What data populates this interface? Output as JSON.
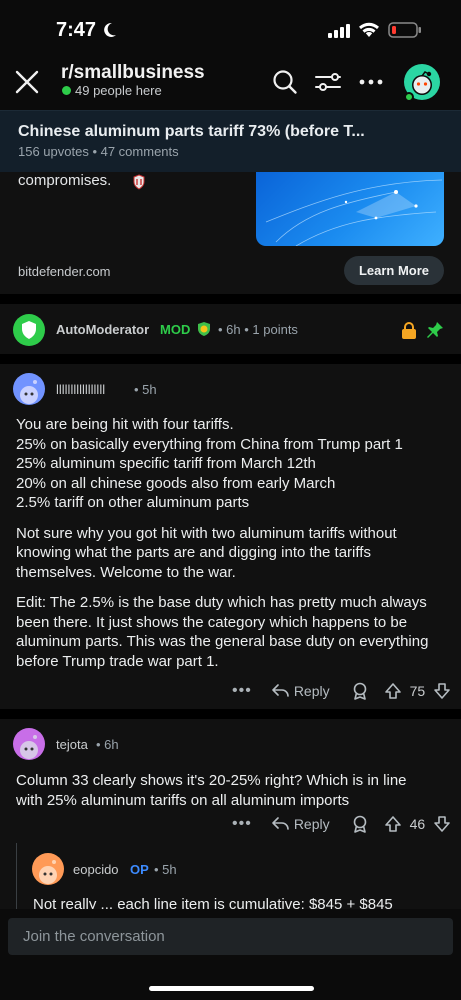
{
  "status_bar": {
    "time": "7:47"
  },
  "header": {
    "subreddit": "r/smallbusiness",
    "online": "49 people here"
  },
  "pinned_post": {
    "title": "Chinese aluminum parts tariff 73% (before T...",
    "meta": "156 upvotes • 47 comments"
  },
  "ad": {
    "text": "compromises.",
    "domain": "bitdefender.com",
    "button": "Learn More"
  },
  "mod_comment": {
    "user": "AutoModerator",
    "badge": "MOD",
    "meta": "• 6h • 1 points"
  },
  "comments": [
    {
      "user": "lllllllllllllllll",
      "time": "• 5h",
      "paragraphs": [
        "You are being hit with four tariffs.",
        "25% on basically everything from China from Trump part 1",
        "25% aluminum specific tariff from March 12th",
        "20% on all chinese goods also from early March",
        "2.5% tariff on other aluminum parts"
      ],
      "paragraphs2": [
        "Not sure why you got hit with two aluminum tariffs without knowing what the parts are and digging into the tariffs themselves. Welcome to the war.",
        "Edit: The 2.5% is the base duty which has pretty much always been there. It just shows the category which happens to be aluminum parts. This was the general base duty on everything before Trump trade war part 1."
      ],
      "reply": "Reply",
      "votes": "75"
    },
    {
      "user": "tejota",
      "time": "• 6h",
      "paragraphs": [
        "Column 33 clearly shows it's 20-25% right? Which is in line with 25% aluminum tariffs on all aluminum imports"
      ],
      "reply": "Reply",
      "votes": "46"
    },
    {
      "user": "eopcido",
      "op": "OP",
      "time": "• 5h",
      "preview": "Not really ... each line item is cumulative: $845 + $845"
    }
  ],
  "composer": {
    "placeholder": "Join the conversation"
  }
}
